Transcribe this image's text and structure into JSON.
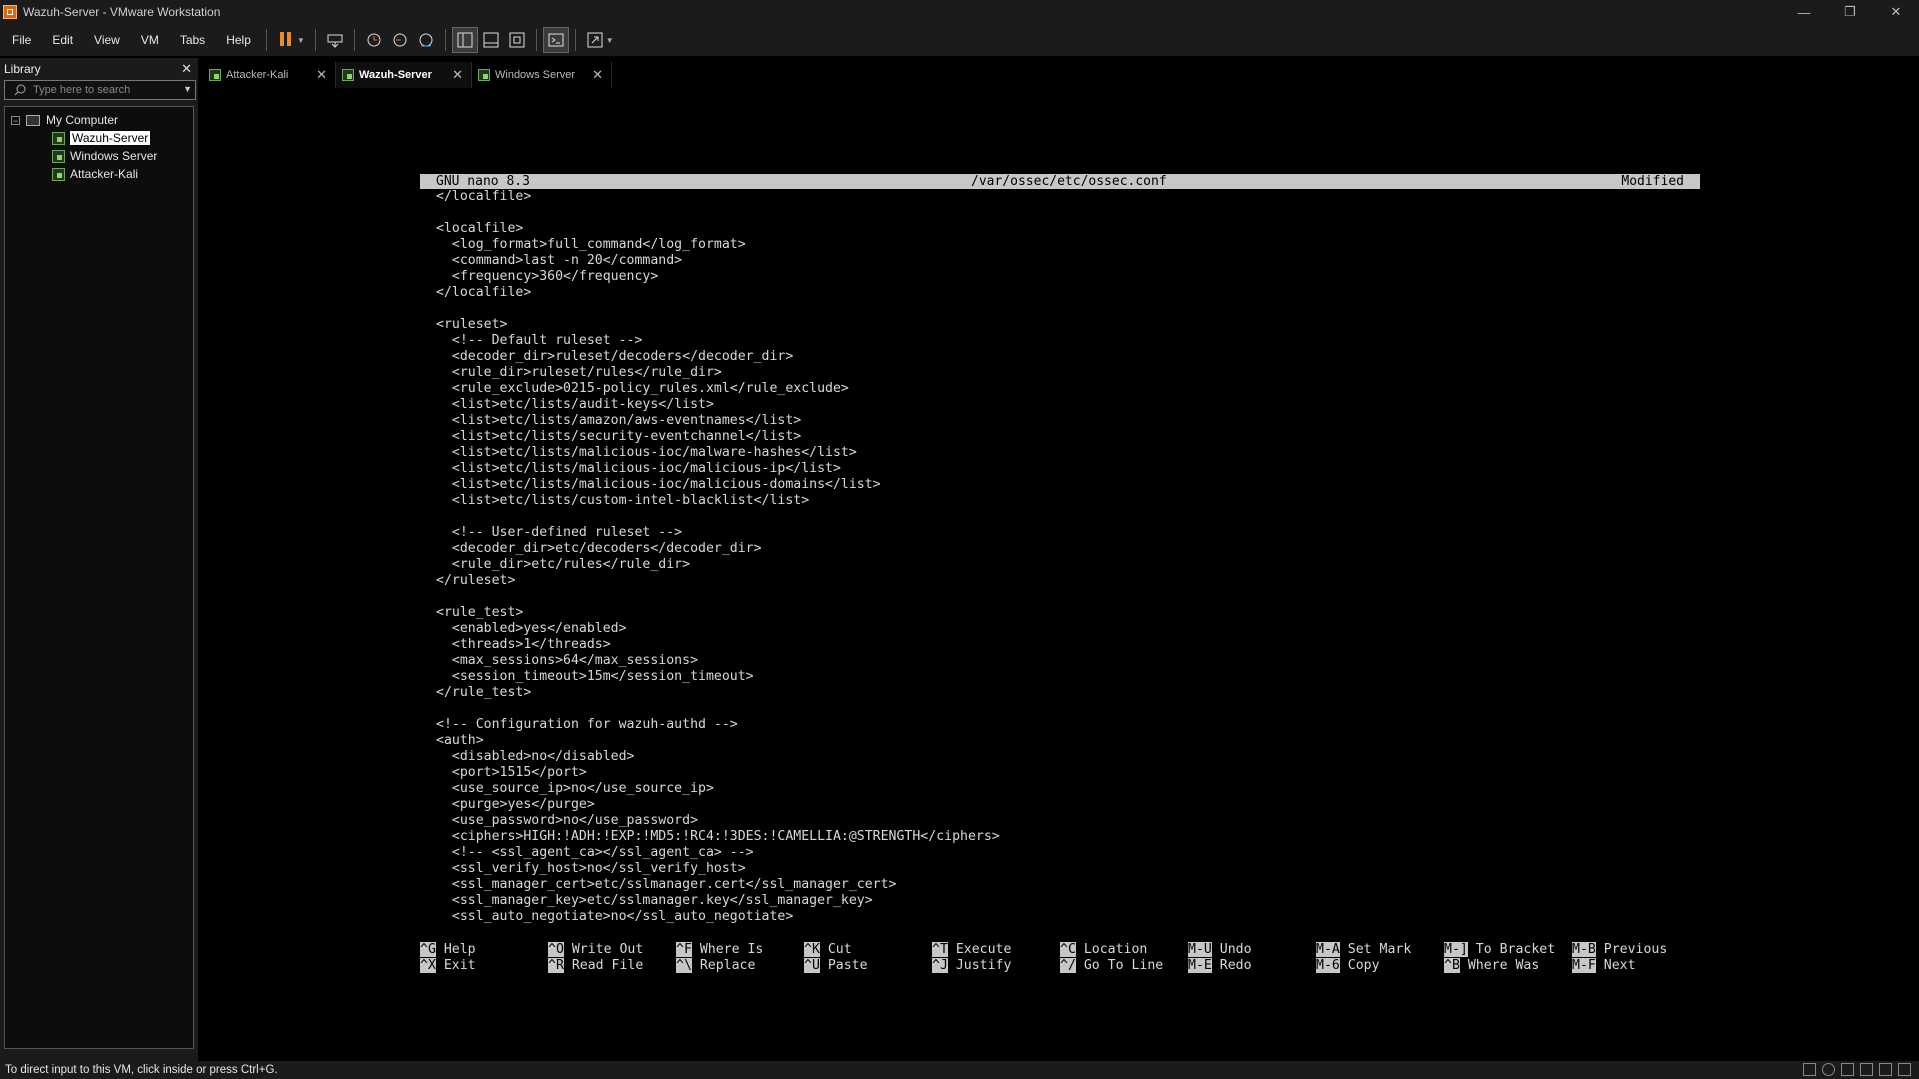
{
  "window": {
    "title": "Wazuh-Server - VMware Workstation"
  },
  "menu": [
    "File",
    "Edit",
    "View",
    "VM",
    "Tabs",
    "Help"
  ],
  "library": {
    "title": "Library",
    "search_placeholder": "Type here to search",
    "root": "My Computer",
    "items": [
      "Wazuh-Server",
      "Windows Server",
      "Attacker-Kali"
    ],
    "selected": "Wazuh-Server"
  },
  "tabs": [
    {
      "label": "Attacker-Kali",
      "active": false
    },
    {
      "label": "Wazuh-Server",
      "active": true
    },
    {
      "label": "Windows Server",
      "active": false
    }
  ],
  "nano": {
    "version": "GNU nano 8.3",
    "filename": "/var/ossec/etc/ossec.conf",
    "status": "Modified",
    "lines": [
      "</localfile>",
      "",
      "<localfile>",
      "  <log_format>full_command</log_format>",
      "  <command>last -n 20</command>",
      "  <frequency>360</frequency>",
      "</localfile>",
      "",
      "<ruleset>",
      "  <!-- Default ruleset -->",
      "  <decoder_dir>ruleset/decoders</decoder_dir>",
      "  <rule_dir>ruleset/rules</rule_dir>",
      "  <rule_exclude>0215-policy_rules.xml</rule_exclude>",
      "  <list>etc/lists/audit-keys</list>",
      "  <list>etc/lists/amazon/aws-eventnames</list>",
      "  <list>etc/lists/security-eventchannel</list>",
      "  <list>etc/lists/malicious-ioc/malware-hashes</list>",
      "  <list>etc/lists/malicious-ioc/malicious-ip</list>",
      "  <list>etc/lists/malicious-ioc/malicious-domains</list>",
      "  <list>etc/lists/custom-intel-blacklist</list>",
      "",
      "  <!-- User-defined ruleset -->",
      "  <decoder_dir>etc/decoders</decoder_dir>",
      "  <rule_dir>etc/rules</rule_dir>",
      "</ruleset>",
      "",
      "<rule_test>",
      "  <enabled>yes</enabled>",
      "  <threads>1</threads>",
      "  <max_sessions>64</max_sessions>",
      "  <session_timeout>15m</session_timeout>",
      "</rule_test>",
      "",
      "<!-- Configuration for wazuh-authd -->",
      "<auth>",
      "  <disabled>no</disabled>",
      "  <port>1515</port>",
      "  <use_source_ip>no</use_source_ip>",
      "  <purge>yes</purge>",
      "  <use_password>no</use_password>",
      "  <ciphers>HIGH:!ADH:!EXP:!MD5:!RC4:!3DES:!CAMELLIA:@STRENGTH</ciphers>",
      "  <!-- <ssl_agent_ca></ssl_agent_ca> -->",
      "  <ssl_verify_host>no</ssl_verify_host>",
      "  <ssl_manager_cert>etc/sslmanager.cert</ssl_manager_cert>",
      "  <ssl_manager_key>etc/sslmanager.key</ssl_manager_key>",
      "  <ssl_auto_negotiate>no</ssl_auto_negotiate>"
    ],
    "shortcuts": [
      [
        {
          "key": "^G",
          "label": "Help"
        },
        {
          "key": "^O",
          "label": "Write Out"
        },
        {
          "key": "^F",
          "label": "Where Is"
        },
        {
          "key": "^K",
          "label": "Cut"
        },
        {
          "key": "^T",
          "label": "Execute"
        },
        {
          "key": "^C",
          "label": "Location"
        },
        {
          "key": "M-U",
          "label": "Undo"
        },
        {
          "key": "M-A",
          "label": "Set Mark"
        },
        {
          "key": "M-]",
          "label": "To Bracket"
        },
        {
          "key": "M-B",
          "label": "Previous"
        }
      ],
      [
        {
          "key": "^X",
          "label": "Exit"
        },
        {
          "key": "^R",
          "label": "Read File"
        },
        {
          "key": "^\\",
          "label": "Replace"
        },
        {
          "key": "^U",
          "label": "Paste"
        },
        {
          "key": "^J",
          "label": "Justify"
        },
        {
          "key": "^/",
          "label": "Go To Line"
        },
        {
          "key": "M-E",
          "label": "Redo"
        },
        {
          "key": "M-6",
          "label": "Copy"
        },
        {
          "key": "^B",
          "label": "Where Was"
        },
        {
          "key": "M-F",
          "label": "Next"
        }
      ]
    ]
  },
  "status": {
    "text": "To direct input to this VM, click inside or press Ctrl+G."
  },
  "icons": {
    "app": "vmware-icon",
    "pause": "pause-icon",
    "send_keys": "send-ctrl-alt-del-icon",
    "snapshot": "snapshot-icon",
    "revert": "revert-snapshot-icon",
    "manager": "snapshot-manager-icon",
    "library_view": "library-view-icon",
    "thumbnail": "thumbnail-bar-icon",
    "fullscreen": "full-screen-icon",
    "console": "console-view-icon",
    "stretch": "stretch-guest-icon"
  }
}
